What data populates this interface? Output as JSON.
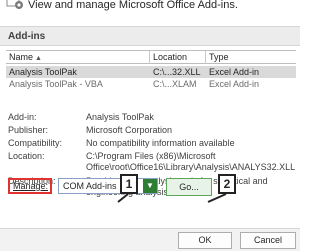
{
  "header": {
    "title": "View and manage Microsoft Office Add-ins."
  },
  "section": {
    "label": "Add-ins"
  },
  "grid": {
    "columns": [
      "Name",
      "Location",
      "Type"
    ],
    "sort_glyph": "▲",
    "rows": [
      {
        "name": "Analysis ToolPak",
        "location": "C:\\...32.XLL",
        "type": "Excel Add-in"
      },
      {
        "name": "Analysis ToolPak - VBA",
        "location": "C:\\...XLAM",
        "type": "Excel Add-in"
      }
    ]
  },
  "details": {
    "addin_label": "Add-in:",
    "addin_value": "Analysis ToolPak",
    "publisher_label": "Publisher:",
    "publisher_value": "Microsoft Corporation",
    "compat_label": "Compatibility:",
    "compat_value": "No compatibility information available",
    "location_label": "Location:",
    "location_value": "C:\\Program Files (x86)\\Microsoft Office\\root\\Office16\\Library\\Analysis\\ANALYS32.XLL",
    "description_label": "Description:",
    "description_value": "Provides data analysis tools for statistical and engineering analysis"
  },
  "manage": {
    "label": "Manage:",
    "selected": "COM Add-ins",
    "go_label": "Go..."
  },
  "callouts": {
    "one": "1",
    "two": "2"
  },
  "footer": {
    "ok_label": "OK",
    "cancel_label": "Cancel"
  },
  "colors": {
    "highlight_red": "#e0332f",
    "select_button_green": "#2e7d32",
    "selected_row": "#d9d9d9"
  }
}
